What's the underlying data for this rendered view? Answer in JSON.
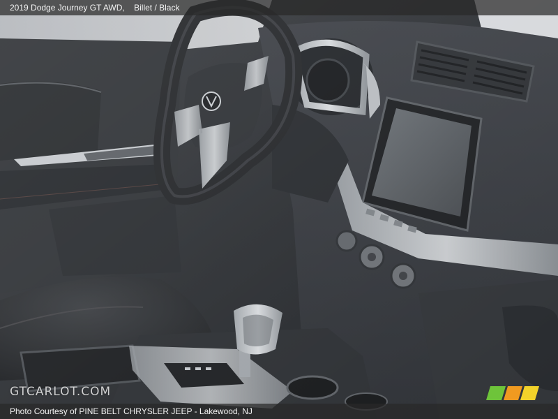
{
  "caption": {
    "title": "2019 Dodge Journey GT AWD,",
    "trim": "Billet / Black"
  },
  "credit": {
    "text": "Photo Courtesy of PINE BELT CHRYSLER JEEP - Lakewood, NJ"
  },
  "watermark": {
    "text": "GTCARLOT.COM"
  },
  "brand_colors": {
    "green": "#6ec43a",
    "orange": "#f09a20",
    "yellow": "#f2d22a"
  }
}
